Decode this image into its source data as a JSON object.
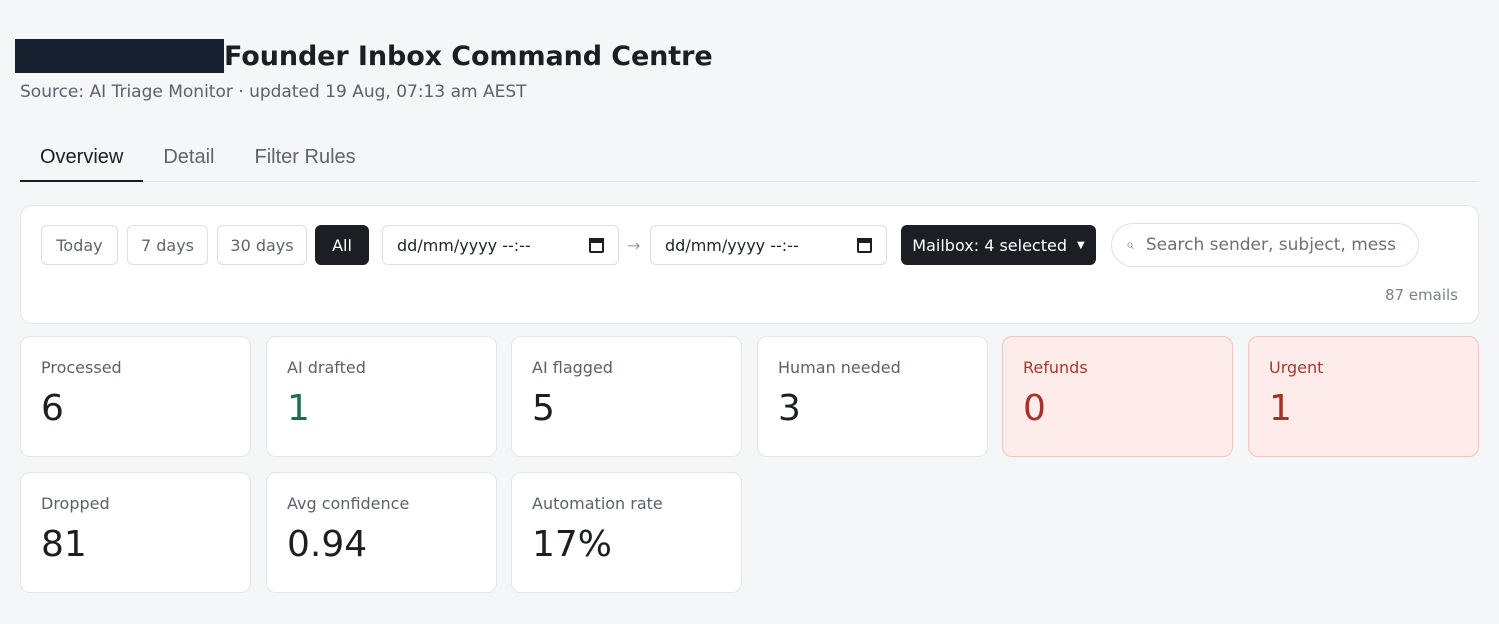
{
  "header": {
    "title": "Founder Inbox Command Centre",
    "subtitle": "Source: AI Triage Monitor · updated 19 Aug, 07:13 am AEST"
  },
  "tabs": [
    {
      "label": "Overview",
      "active": true
    },
    {
      "label": "Detail",
      "active": false
    },
    {
      "label": "Filter Rules",
      "active": false
    }
  ],
  "filters": {
    "ranges": [
      {
        "label": "Today",
        "active": false
      },
      {
        "label": "7 days",
        "active": false
      },
      {
        "label": "30 days",
        "active": false
      },
      {
        "label": "All",
        "active": true
      }
    ],
    "date_from_placeholder": "dd/mm/yyyy --:--",
    "date_to_placeholder": "dd/mm/yyyy --:--",
    "separator": "→",
    "mailbox_label": "Mailbox: 4 selected",
    "search_placeholder": "Search sender, subject, message",
    "email_count": "87 emails"
  },
  "metrics": [
    {
      "label": "Processed",
      "value": "6"
    },
    {
      "label": "AI drafted",
      "value": "1",
      "color": "#1e6b57"
    },
    {
      "label": "AI flagged",
      "value": "5"
    },
    {
      "label": "Human needed",
      "value": "3"
    },
    {
      "label": "Refunds",
      "value": "0",
      "alert": true
    },
    {
      "label": "Urgent",
      "value": "1",
      "alert": true
    },
    {
      "label": "Dropped",
      "value": "81"
    },
    {
      "label": "Avg confidence",
      "value": "0.94"
    },
    {
      "label": "Automation rate",
      "value": "17%"
    }
  ],
  "colors": {
    "accent_dark": "#1b1f24",
    "alert_bg": "#fdecea",
    "alert_text": "#a6322a",
    "positive": "#1e6b57"
  }
}
